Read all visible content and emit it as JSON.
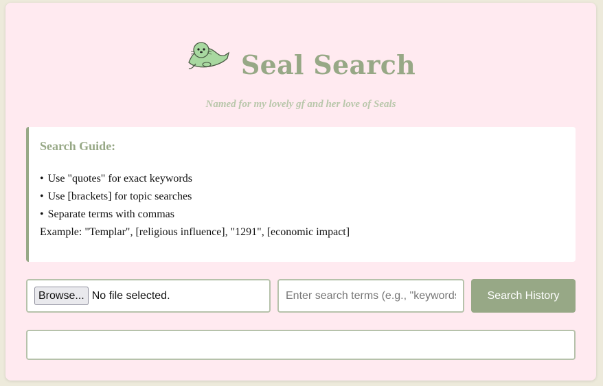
{
  "header": {
    "title": "Seal Search",
    "subtitle": "Named for my lovely gf and her love of Seals",
    "logo_icon": "seal-icon"
  },
  "guide": {
    "title": "Search Guide:",
    "bullets": [
      "Use \"quotes\" for exact keywords",
      "Use [brackets] for topic searches",
      "Separate terms with commas"
    ],
    "example": "Example: \"Templar\", [religious influence], \"1291\", [economic impact]"
  },
  "controls": {
    "browse_label": "Browse...",
    "file_status": "No file selected.",
    "search_placeholder": "Enter search terms (e.g., \"keywords\", [topics])",
    "search_value": "",
    "search_button": "Search History"
  },
  "results": {
    "text": ""
  },
  "colors": {
    "page_bg": "#edeadb",
    "card_bg": "#ffeaf0",
    "accent": "#97a886",
    "seal_body": "#a8d8a0"
  }
}
